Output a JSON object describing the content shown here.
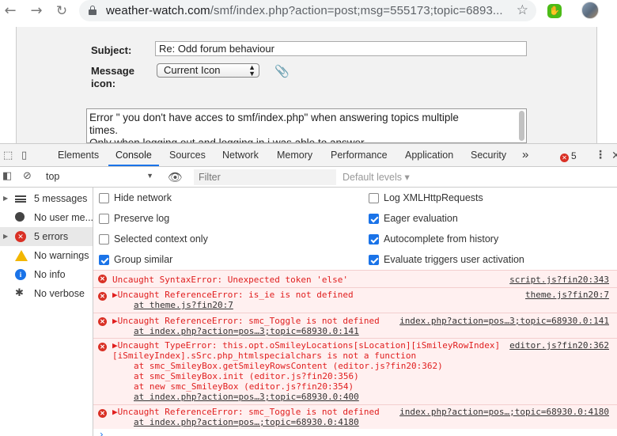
{
  "browser": {
    "url_host": "weather-watch.com",
    "url_rest": "/smf/index.php?action=post;msg=555173;topic=6893..."
  },
  "page": {
    "subject_label": "Subject:",
    "subject_value": "Re: Odd forum behaviour",
    "icon_label_line1": "Message",
    "icon_label_line2": "icon:",
    "icon_select_value": "Current Icon",
    "message_line1": "Error \" you don't have acces to smf/index.php\" when answering topics multiple",
    "message_line2": "times.",
    "message_line3": "Only when logging out and logging in i was able to answer"
  },
  "devtools": {
    "tabs": [
      "Elements",
      "Console",
      "Sources",
      "Network",
      "Memory",
      "Performance",
      "Application",
      "Security"
    ],
    "active_tab": "Console",
    "more_tabs": "»",
    "error_count": "5"
  },
  "console_bar": {
    "context": "top",
    "filter_placeholder": "Filter",
    "levels": "Default levels ▾"
  },
  "sidebar": {
    "items": [
      {
        "label": "5 messages",
        "icon": "list-icon"
      },
      {
        "label": "No user me...",
        "icon": "user-icon"
      },
      {
        "label": "5 errors",
        "icon": "error-icon"
      },
      {
        "label": "No warnings",
        "icon": "warning-icon"
      },
      {
        "label": "No info",
        "icon": "info-icon"
      },
      {
        "label": "No verbose",
        "icon": "bug-icon"
      }
    ]
  },
  "settings": {
    "left": [
      {
        "label": "Hide network",
        "checked": false
      },
      {
        "label": "Preserve log",
        "checked": false
      },
      {
        "label": "Selected context only",
        "checked": false
      },
      {
        "label": "Group similar",
        "checked": true
      }
    ],
    "right": [
      {
        "label": "Log XMLHttpRequests",
        "checked": false
      },
      {
        "label": "Eager evaluation",
        "checked": true
      },
      {
        "label": "Autocomplete from history",
        "checked": true
      },
      {
        "label": "Evaluate triggers user activation",
        "checked": true
      }
    ]
  },
  "messages": [
    {
      "text": "Uncaught SyntaxError: Unexpected token 'else'",
      "source": "script.js?fin20:343"
    },
    {
      "text": "▶Uncaught ReferenceError: is_ie is not defined",
      "source": "theme.js?fin20:7",
      "trace": [
        "at theme.js?fin20:7"
      ]
    },
    {
      "text": "▶Uncaught ReferenceError: smc_Toggle is not defined",
      "source": "index.php?action=pos…3;topic=68930.0:141",
      "trace": [
        "at index.php?action=pos…3;topic=68930.0:141"
      ]
    },
    {
      "text": "▶Uncaught TypeError: this.opt.oSmileyLocations[sLocation][iSmileyRowIndex]",
      "source": "editor.js?fin20:362",
      "line2": "[iSmileyIndex].sSrc.php_htmlspecialchars is not a function",
      "trace": [
        "at smc_SmileyBox.getSmileyRowsContent (editor.js?fin20:362)",
        "at smc_SmileyBox.init (editor.js?fin20:356)",
        "at new smc_SmileyBox (editor.js?fin20:354)",
        "at index.php?action=pos…3;topic=68930.0:400"
      ]
    },
    {
      "text": "▶Uncaught ReferenceError: smc_Toggle is not defined",
      "source": "index.php?action=pos…;topic=68930.0:4180",
      "trace": [
        "at index.php?action=pos…;topic=68930.0:4180"
      ]
    }
  ],
  "colors": {
    "error_red": "#d93025",
    "accent_blue": "#1a73e8"
  }
}
